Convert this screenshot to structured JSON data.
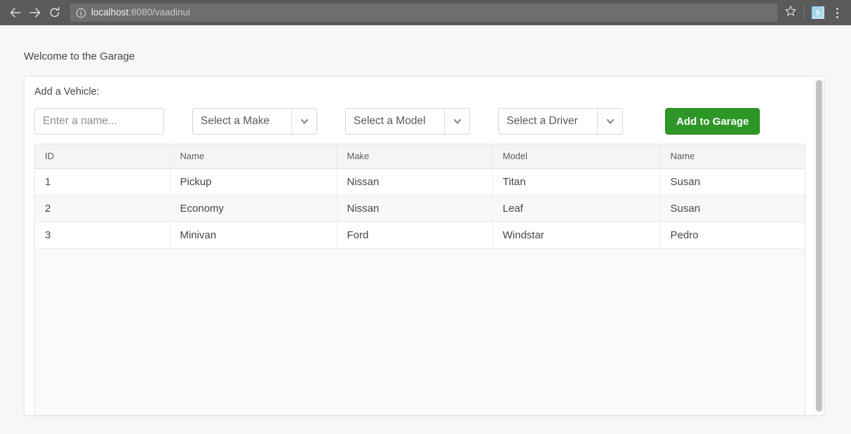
{
  "browser": {
    "back_icon": "arrow-left-icon",
    "forward_icon": "arrow-right-icon",
    "reload_icon": "reload-icon",
    "info_icon": "info-circle-icon",
    "url_host": "localhost",
    "url_rest": ":8080/vaadinui",
    "star_icon": "star-icon",
    "extension_icon_label": "S",
    "menu_icon": "three-dot-menu-icon"
  },
  "page": {
    "welcome_text": "Welcome to the Garage"
  },
  "form": {
    "title": "Add a Vehicle:",
    "name_input": {
      "value": "",
      "placeholder": "Enter a name..."
    },
    "make_select": {
      "selected": "Select a Make",
      "arrow_icon": "chevron-down-icon"
    },
    "model_select": {
      "selected": "Select a Model",
      "arrow_icon": "chevron-down-icon"
    },
    "driver_select": {
      "selected": "Select a Driver",
      "arrow_icon": "chevron-down-icon"
    },
    "submit_label": "Add to Garage",
    "submit_color": "#2e9627"
  },
  "grid": {
    "columns": [
      "ID",
      "Name",
      "Make",
      "Model",
      "Name"
    ],
    "rows": [
      {
        "id": "1",
        "name": "Pickup",
        "make": "Nissan",
        "model": "Titan",
        "driver": "Susan"
      },
      {
        "id": "2",
        "name": "Economy",
        "make": "Nissan",
        "model": "Leaf",
        "driver": "Susan"
      },
      {
        "id": "3",
        "name": "Minivan",
        "make": "Ford",
        "model": "Windstar",
        "driver": "Pedro"
      }
    ]
  }
}
